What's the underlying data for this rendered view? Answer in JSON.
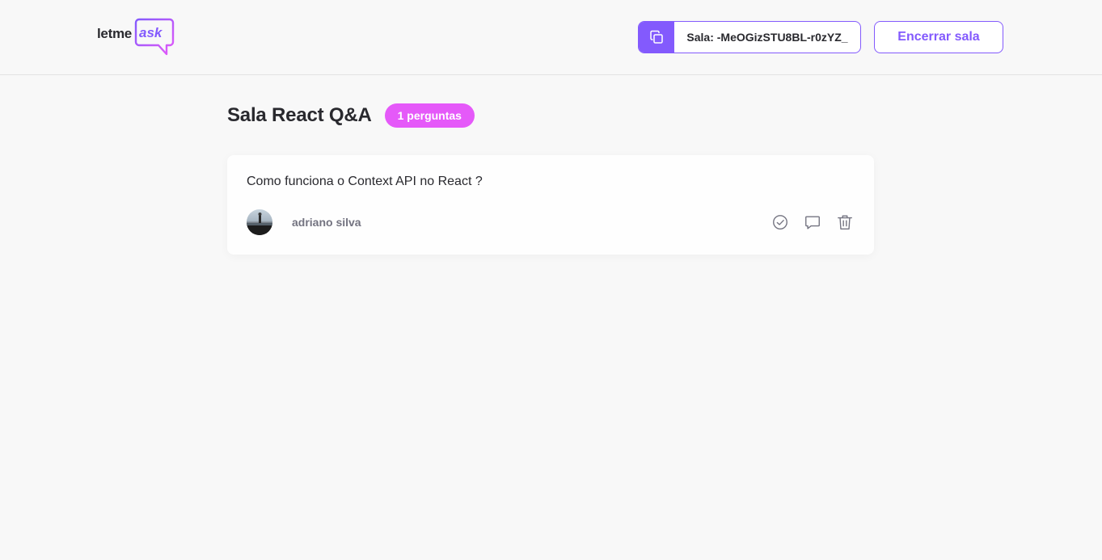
{
  "app": {
    "logo_text_1": "letme",
    "logo_text_2": "ask",
    "brand_color": "#835afd",
    "accent_pink": "#e559f9"
  },
  "header": {
    "room_code_label": "Sala: -MeOGizSTU8BL-r0zYZ_",
    "copy_icon": "copy-icon",
    "end_room_label": "Encerrar sala"
  },
  "room": {
    "title": "Sala React Q&A",
    "question_count": "1 perguntas"
  },
  "questions": [
    {
      "content": "Como funciona o Context API no React ?",
      "author_name": "adriano silva",
      "actions": [
        "check-circle-icon",
        "chat-bubble-icon",
        "trash-icon"
      ]
    }
  ]
}
